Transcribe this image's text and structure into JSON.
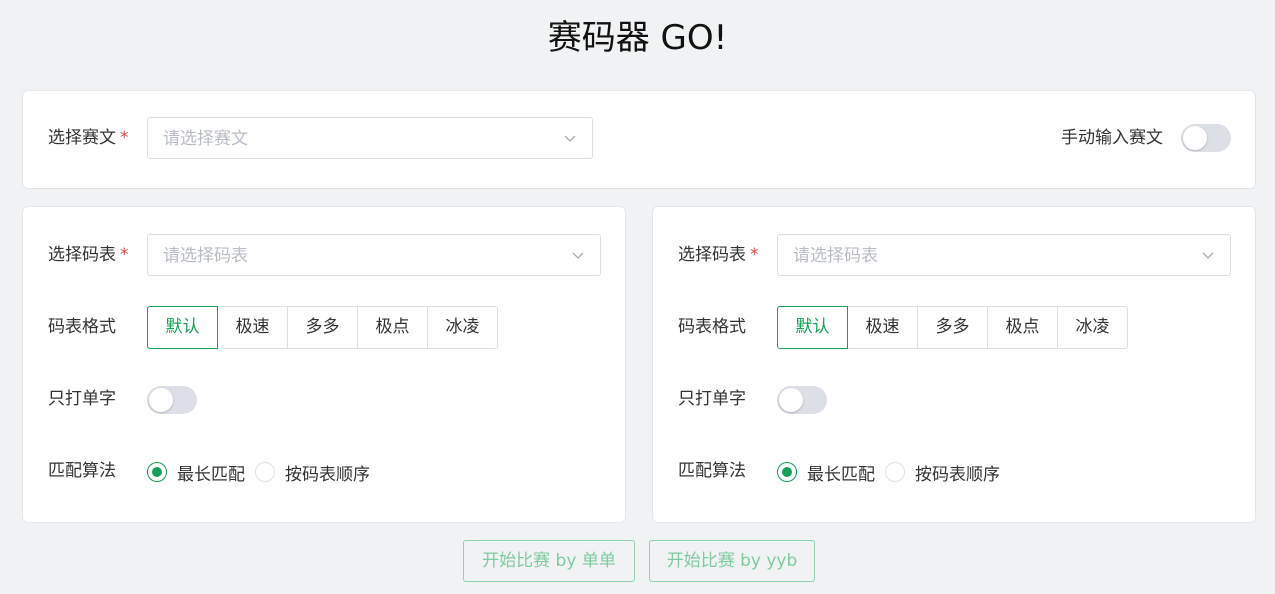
{
  "title": "赛码器 GO!",
  "text_select": {
    "label": "选择赛文",
    "required_mark": "*",
    "placeholder": "请选择赛文"
  },
  "manual_input": {
    "label": "手动输入赛文",
    "enabled": false
  },
  "panels": [
    {
      "table_label": "选择码表",
      "required_mark": "*",
      "table_placeholder": "请选择码表",
      "format_label": "码表格式",
      "formats": [
        "默认",
        "极速",
        "多多",
        "极点",
        "冰凌"
      ],
      "selected_format": "默认",
      "single_char_label": "只打单字",
      "single_char_enabled": false,
      "algo_label": "匹配算法",
      "algos": [
        "最长匹配",
        "按码表顺序"
      ],
      "selected_algo": "最长匹配"
    },
    {
      "table_label": "选择码表",
      "required_mark": "*",
      "table_placeholder": "请选择码表",
      "format_label": "码表格式",
      "formats": [
        "默认",
        "极速",
        "多多",
        "极点",
        "冰凌"
      ],
      "selected_format": "默认",
      "single_char_label": "只打单字",
      "single_char_enabled": false,
      "algo_label": "匹配算法",
      "algos": [
        "最长匹配",
        "按码表顺序"
      ],
      "selected_algo": "最长匹配"
    }
  ],
  "buttons": {
    "start_dandan": "开始比赛 by 单单",
    "start_yyb": "开始比赛 by yyb"
  },
  "colors": {
    "accent": "#18a058",
    "required": "#e04848",
    "background": "#f0f2f3"
  }
}
